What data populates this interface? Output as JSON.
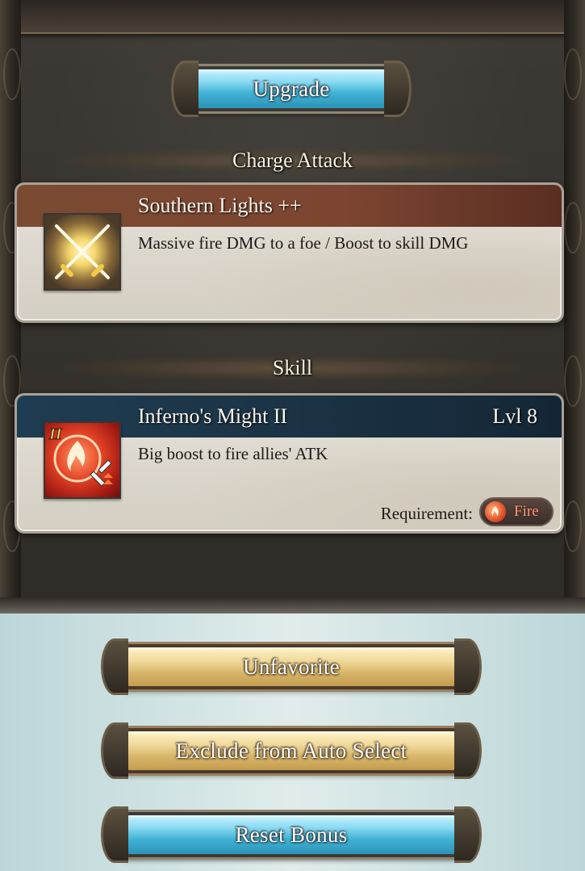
{
  "top": {
    "upgrade_label": "Upgrade"
  },
  "charge_attack": {
    "header": "Charge Attack",
    "name": "Southern Lights ++",
    "description": "Massive fire DMG to a foe / Boost to skill DMG",
    "icon": "crossed-swords-icon"
  },
  "skill": {
    "header": "Skill",
    "name": "Inferno's Might II",
    "level": "Lvl 8",
    "description": "Big boost to fire allies' ATK",
    "icon": "fire-atk-up-icon",
    "icon_badge": "II",
    "requirement_label": "Requirement:",
    "requirement_element": "Fire",
    "requirement_color": "#ff9a78"
  },
  "actions": {
    "unfavorite_label": "Unfavorite",
    "exclude_label": "Exclude from Auto Select",
    "reset_label": "Reset Bonus"
  },
  "colors": {
    "blue_button": "#43b4d6",
    "gold_button": "#d8b66a",
    "panel_bg": "#34312c",
    "ca_titlebar": "#7a4a32",
    "skill_titlebar": "#1f3d52"
  }
}
